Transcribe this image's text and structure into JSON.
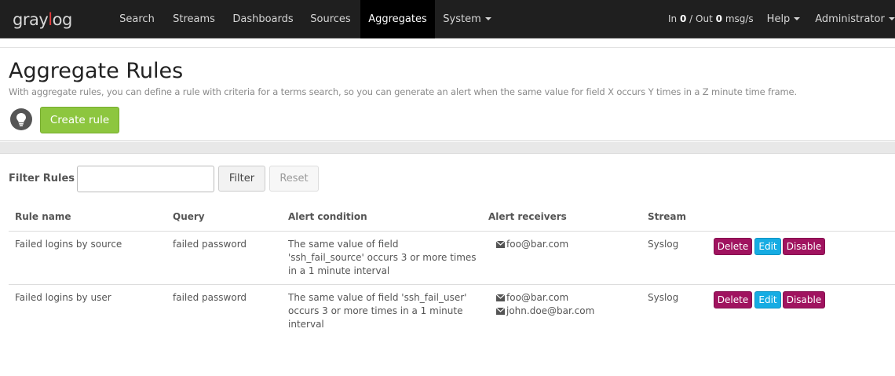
{
  "app": {
    "brand_prefix": "graylog"
  },
  "nav": {
    "items": [
      {
        "label": "Search"
      },
      {
        "label": "Streams"
      },
      {
        "label": "Dashboards"
      },
      {
        "label": "Sources"
      },
      {
        "label": "Aggregates",
        "active": true
      },
      {
        "label": "System",
        "dropdown": true
      }
    ],
    "throughput": {
      "in_label": "In",
      "in_value": "0",
      "sep": "/ Out",
      "out_value": "0",
      "unit": "msg/s"
    },
    "help": {
      "label": "Help"
    },
    "user": {
      "label": "Administrator"
    }
  },
  "header": {
    "title": "Aggregate Rules",
    "description": "With aggregate rules, you can define a rule with criteria for a terms search, so you can generate an alert when the same value for field X occurs Y times in a Z minute time frame.",
    "create_button": "Create rule",
    "help_icon": "lightbulb-icon"
  },
  "filter": {
    "label": "Filter Rules",
    "input_value": "",
    "filter_button": "Filter",
    "reset_button": "Reset"
  },
  "table": {
    "columns": [
      "Rule name",
      "Query",
      "Alert condition",
      "Alert receivers",
      "Stream"
    ],
    "rows": [
      {
        "name": "Failed logins by source",
        "query": "failed password",
        "condition": "The same value of field 'ssh_fail_source' occurs 3 or more times in a 1 minute interval",
        "receivers": [
          "foo@bar.com"
        ],
        "stream": "Syslog",
        "actions": {
          "delete": "Delete",
          "edit": "Edit",
          "disable": "Disable"
        }
      },
      {
        "name": "Failed logins by user",
        "query": "failed password",
        "condition": "The same value of field 'ssh_fail_user' occurs 3 or more times in a 1 minute interval",
        "receivers": [
          "foo@bar.com",
          "john.doe@bar.com"
        ],
        "stream": "Syslog",
        "actions": {
          "delete": "Delete",
          "edit": "Edit",
          "disable": "Disable"
        }
      }
    ]
  },
  "colors": {
    "navbar": "#1f1f1f",
    "brand_accent": "#e43c3c",
    "create_button": "#8dc63f",
    "danger": "#a0135f",
    "info": "#16ace3"
  }
}
